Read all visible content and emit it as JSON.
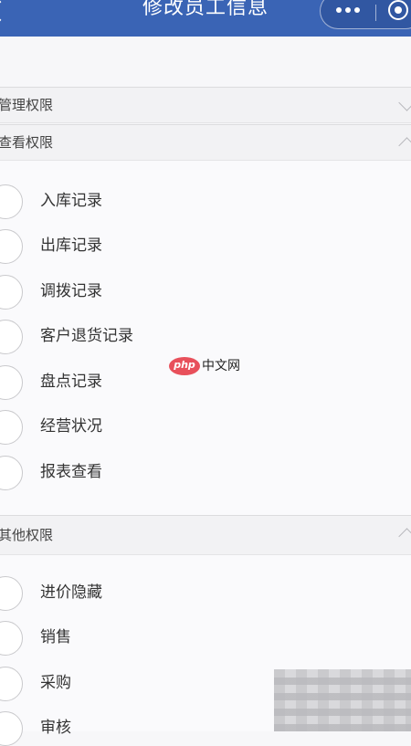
{
  "navbar": {
    "title": "修改员工信息"
  },
  "sections": [
    {
      "title": "管理权限",
      "expanded": false
    },
    {
      "title": "查看权限",
      "expanded": true
    },
    {
      "title": "其他权限",
      "expanded": true
    }
  ],
  "view_permissions": [
    {
      "label": "入库记录",
      "checked": false
    },
    {
      "label": "出库记录",
      "checked": false
    },
    {
      "label": "调拨记录",
      "checked": false
    },
    {
      "label": "客户退货记录",
      "checked": false
    },
    {
      "label": "盘点记录",
      "checked": false
    },
    {
      "label": "经营状况",
      "checked": false
    },
    {
      "label": "报表查看",
      "checked": false
    }
  ],
  "other_permissions": [
    {
      "label": "进价隐藏",
      "checked": false
    },
    {
      "label": "销售",
      "checked": false
    },
    {
      "label": "采购",
      "checked": false
    },
    {
      "label": "审核",
      "checked": false
    }
  ],
  "watermark": {
    "logo": "php",
    "text": "中文网"
  },
  "colors": {
    "navbar": "#3a64b5",
    "background": "#f7f7f9",
    "section_header": "#f2f2f4"
  }
}
